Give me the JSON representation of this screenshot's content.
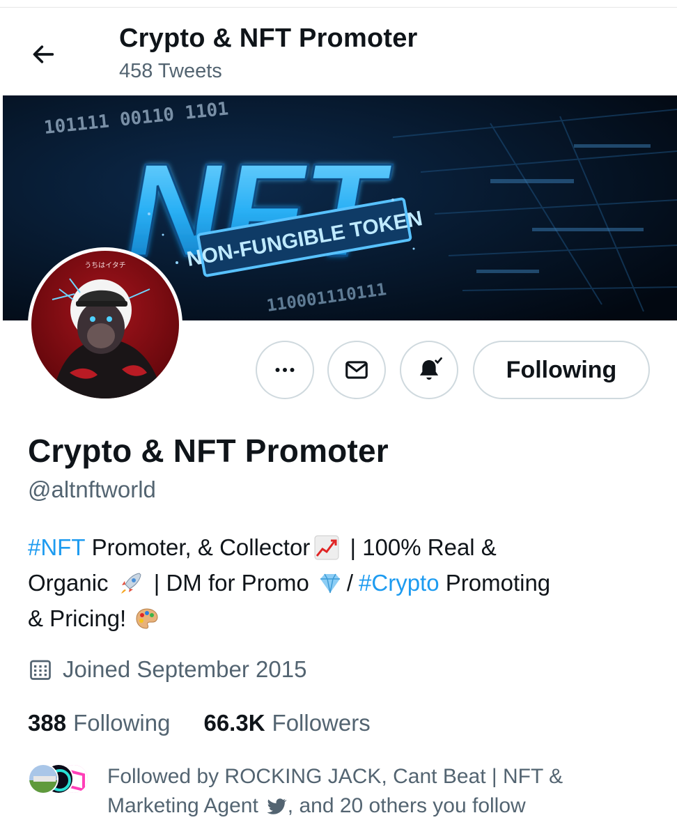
{
  "header": {
    "title": "Crypto & NFT Promoter",
    "tweet_count": "458 Tweets"
  },
  "banner": {
    "big_text": "NFT",
    "sub_text": "NON-FUNGIBLE TOKEN",
    "binary_top": "101111 00110 1101",
    "binary_bottom": "110001110111"
  },
  "avatar": {
    "tag": "うちはイタチ"
  },
  "actions": {
    "following_label": "Following"
  },
  "profile": {
    "display_name": "Crypto & NFT Promoter",
    "handle": "@altnftworld"
  },
  "bio": {
    "line1_tag": "#NFT",
    "line1_text": " Promoter, & Collector",
    "line1_tail": " | 100% Real &",
    "line2_text": "Organic",
    "line2_mid": " | DM for Promo",
    "line2_sep": "/",
    "line2_tag": "#Crypto",
    "line2_tail": " Promoting",
    "line3_text": "& Pricing!"
  },
  "meta": {
    "joined": "Joined September 2015"
  },
  "stats": {
    "following_count": "388",
    "following_label": "Following",
    "followers_count": "66.3K",
    "followers_label": "Followers"
  },
  "followed_by": {
    "line1": "Followed by ROCKING JACK, Cant Beat | NFT &",
    "line2a": "Marketing Agent",
    "line2b": ", and 20 others you follow"
  },
  "colors": {
    "accent": "#1d9bf0",
    "secondary_text": "#536471",
    "border": "#cfd9de"
  },
  "icons": [
    "back-arrow-icon",
    "more-icon",
    "envelope-icon",
    "bell-check-icon",
    "calendar-icon",
    "chart-emoji-icon",
    "rocket-emoji-icon",
    "gem-emoji-icon",
    "palette-emoji-icon",
    "bird-icon"
  ]
}
